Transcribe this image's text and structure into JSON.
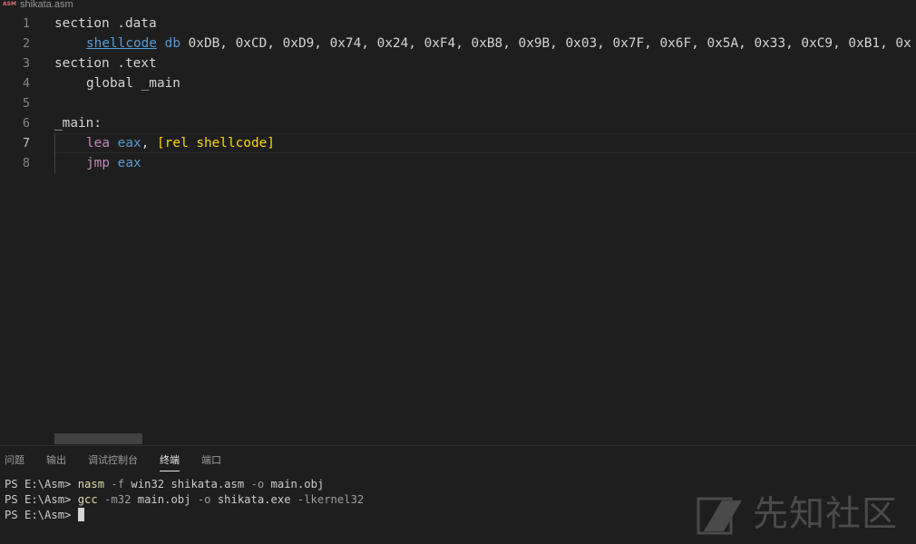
{
  "tab": {
    "icon_label": "ASM",
    "file_name": "shikata.asm"
  },
  "editor": {
    "lines": [
      {
        "num": "1",
        "text": "section .data"
      },
      {
        "num": "2",
        "name": "shellcode",
        "directive": "db",
        "bytes": " 0xDB, 0xCD, 0xD9, 0x74, 0x24, 0xF4, 0xB8, 0x9B, 0x03, 0x7F, 0x6F, 0x5A, 0x33, 0xC9, 0xB1, 0x"
      },
      {
        "num": "3",
        "text": "section .text"
      },
      {
        "num": "4",
        "text": "global _main"
      },
      {
        "num": "5",
        "text": ""
      },
      {
        "num": "6",
        "text": "_main:"
      },
      {
        "num": "7",
        "op": "lea",
        "reg": "eax",
        "comma": ", ",
        "mem": "[rel shellcode]"
      },
      {
        "num": "8",
        "op": "jmp",
        "reg": "eax"
      }
    ]
  },
  "panel": {
    "tabs": [
      {
        "label": "问题"
      },
      {
        "label": "输出"
      },
      {
        "label": "调试控制台"
      },
      {
        "label": "终端",
        "active": true
      },
      {
        "label": "端口"
      }
    ]
  },
  "terminal": {
    "prompt": "PS E:\\Asm> ",
    "line1": {
      "cmd": "nasm",
      "a1": " -f",
      "a2": " win32 shikata.asm ",
      "a3": "-o",
      "a4": " main.obj"
    },
    "line2": {
      "cmd": "gcc",
      "a1": " -m32",
      "a2": " main.obj ",
      "a3": "-o",
      "a4": " shikata.exe ",
      "a5": "-lkernel32"
    }
  },
  "watermark": {
    "text": "先知社区"
  },
  "colors": {
    "background": "#1e1e1e",
    "keyword_blue": "#569cd6",
    "keyword_purple": "#c586c0",
    "bracket_gold": "#ffd700",
    "terminal_command": "#dcdcaa"
  }
}
